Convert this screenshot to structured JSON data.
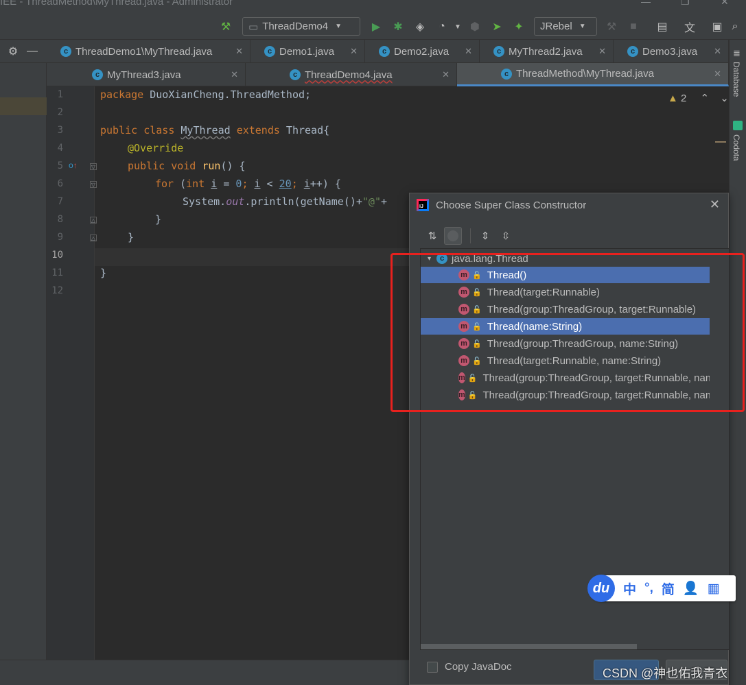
{
  "window": {
    "title": "IEE - ThreadMethod\\MyThread.java - Administrator",
    "minimize": "—",
    "maximize": "❐",
    "close": "✕"
  },
  "toolbar": {
    "run_config": "ThreadDemo4",
    "jrebel": "JRebel"
  },
  "tabs_row1": [
    {
      "label": "ThreadDemo1\\MyThread.java"
    },
    {
      "label": "Demo1.java"
    },
    {
      "label": "Demo2.java"
    },
    {
      "label": "MyThread2.java"
    },
    {
      "label": "Demo3.java"
    }
  ],
  "tabs_row2": [
    {
      "label": "MyThread3.java"
    },
    {
      "label": "ThreadDemo4.java"
    },
    {
      "label": "ThreadMethod\\MyThread.java"
    }
  ],
  "tab_close": "✕",
  "editor": {
    "line_numbers": [
      "1",
      "2",
      "3",
      "4",
      "5",
      "6",
      "7",
      "8",
      "9",
      "10",
      "11",
      "12"
    ],
    "warning_count": "2",
    "code": {
      "l1_kw": "package",
      "l1_rest": " DuoXianCheng.ThreadMethod;",
      "l3_kw1": "public class",
      "l3_name": "MyThread",
      "l3_kw2": "extends",
      "l3_rest": " Thread{",
      "l4_ann": "@Override",
      "l5_kw": "public void",
      "l5_fn": "run",
      "l5_rest": "() {",
      "l6_kw1": "for",
      "l6_p1": " (",
      "l6_kw2": "int",
      "l6_v1": "i",
      "l6_p2": " = ",
      "l6_n1": "0",
      "l6_p3": "; ",
      "l6_v2": "i",
      "l6_p4": " < ",
      "l6_n2": "20",
      "l6_p5": "; ",
      "l6_v3": "i",
      "l6_p6": "++) {",
      "l7_a": "System.",
      "l7_fld": "out",
      "l7_b": ".println(getName()+",
      "l7_str": "\"@\"",
      "l7_c": "+",
      "l8": "}",
      "l9": "}",
      "l11": "}"
    }
  },
  "right_tools": [
    "Database",
    "Codota"
  ],
  "dialog": {
    "title": "Choose Super Class Constructor",
    "root_class": "java.lang.Thread",
    "method_icon": "m",
    "class_icon": "c",
    "constructors": [
      "Thread()",
      "Thread(target:Runnable)",
      "Thread(group:ThreadGroup, target:Runnable)",
      "Thread(name:String)",
      "Thread(group:ThreadGroup, name:String)",
      "Thread(target:Runnable, name:String)",
      "Thread(group:ThreadGroup, target:Runnable, name:String)",
      "Thread(group:ThreadGroup, target:Runnable, name:String, stackSize:long)"
    ],
    "copy_javadoc": "Copy JavaDoc"
  },
  "ime": {
    "logo": "du",
    "items": [
      "中",
      "°,",
      "简",
      "👤",
      "▦"
    ]
  },
  "watermark": "CSDN @神也佑我青衣",
  "colors": {
    "selection": "#4b6eaf",
    "annotation_box": "#e8211e",
    "run_green": "#499c54"
  }
}
